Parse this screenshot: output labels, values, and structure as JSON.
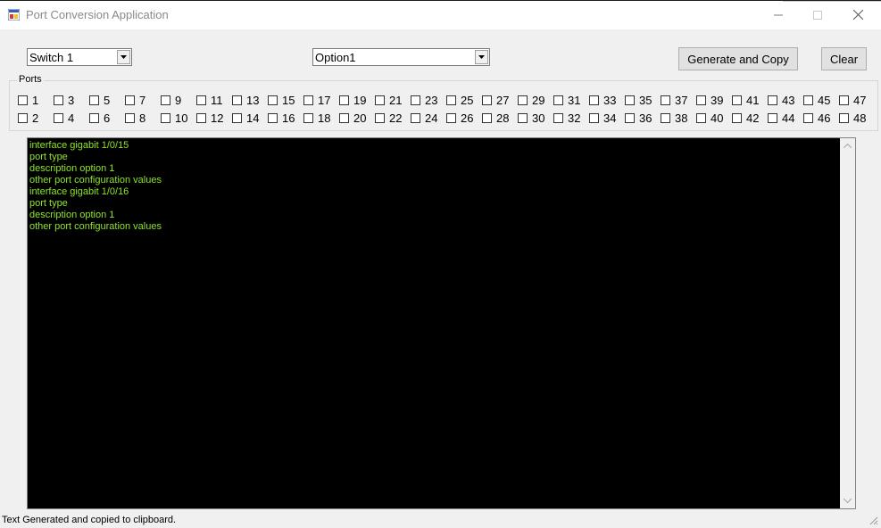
{
  "window": {
    "title": "Port Conversion Application",
    "icon": "app-icon",
    "controls": {
      "minimize": "minimize-icon",
      "maximize": "maximize-icon",
      "close": "close-icon"
    }
  },
  "toolbar": {
    "switch_select": {
      "value": "Switch 1"
    },
    "option_select": {
      "value": "Option1"
    },
    "generate_label": "Generate and Copy",
    "clear_label": "Clear"
  },
  "ports": {
    "legend": "Ports",
    "top_row": [
      "1",
      "3",
      "5",
      "7",
      "9",
      "11",
      "13",
      "15",
      "17",
      "19",
      "21",
      "23",
      "25",
      "27",
      "29",
      "31",
      "33",
      "35",
      "37",
      "39",
      "41",
      "43",
      "45",
      "47"
    ],
    "bottom_row": [
      "2",
      "4",
      "6",
      "8",
      "10",
      "12",
      "14",
      "16",
      "18",
      "20",
      "22",
      "24",
      "26",
      "28",
      "30",
      "32",
      "34",
      "36",
      "38",
      "40",
      "42",
      "44",
      "46",
      "48"
    ]
  },
  "output": {
    "text_color": "#8fe32a",
    "background": "#000000",
    "lines": [
      "interface gigabit 1/0/15",
      "port type",
      "description option 1",
      "other port configuration values",
      "interface gigabit 1/0/16",
      "port type",
      "description option 1",
      "other port configuration values"
    ]
  },
  "status": {
    "text": "Text Generated and copied to clipboard."
  }
}
